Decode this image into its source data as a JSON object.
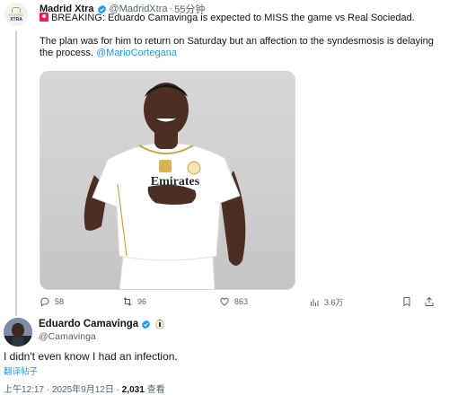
{
  "tweet1": {
    "author_name": "Madrid Xtra",
    "handle": "@MadridXtra",
    "separator": "·",
    "time_ago": "55分钟",
    "avatar_text_top": "MADRID",
    "avatar_text_bottom": "XTRA",
    "paragraph1": "BREAKING: Eduardo Camavinga is expected to MISS the game vs Real Sociedad.",
    "paragraph2_text": "The plan was for him to return on Saturday but an affection to the syndesmosis is delaying the process.",
    "paragraph2_mention": "@MarioCortegana",
    "jersey_sponsor": "Emirates",
    "actions": {
      "replies": "58",
      "reposts": "96",
      "likes": "863",
      "views": "3.6万"
    }
  },
  "tweet2": {
    "author_name": "Eduardo Camavinga",
    "handle": "@Camavinga",
    "text": "I didn't even know I had an infection.",
    "translate_label": "翻译帖子",
    "time": "上午12:17",
    "date": "2025年9月12日",
    "views_count": "2,031",
    "views_label": "查看",
    "separator": "·"
  },
  "colors": {
    "link": "#1d9bf0",
    "verified": "#1d9bf0",
    "secondary_text": "#536471"
  }
}
